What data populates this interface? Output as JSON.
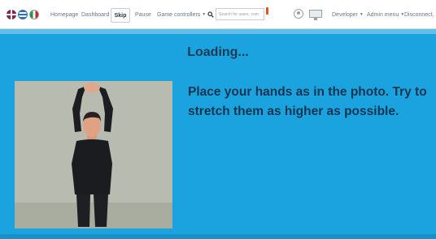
{
  "nav": {
    "flags": [
      "uk-flag-icon",
      "greek-flag-icon",
      "italian-flag-icon"
    ],
    "homepage": "Homepage",
    "dashboard": "Dashboard",
    "skip": "Skip",
    "pause": "Pause",
    "game_controllers": "Game controllers",
    "search_placeholder": "Search for users, com",
    "developer": "Developer",
    "admin_menu": "Admin menu",
    "logout": "Disconnect, Log"
  },
  "main": {
    "loading": "Loading...",
    "instruction": "Place your hands as in the photo. Try to stretch them as higher as possible."
  },
  "colors": {
    "background": "#1ba3e0",
    "heading_text": "#15354f",
    "navbar": "#ffffff"
  }
}
